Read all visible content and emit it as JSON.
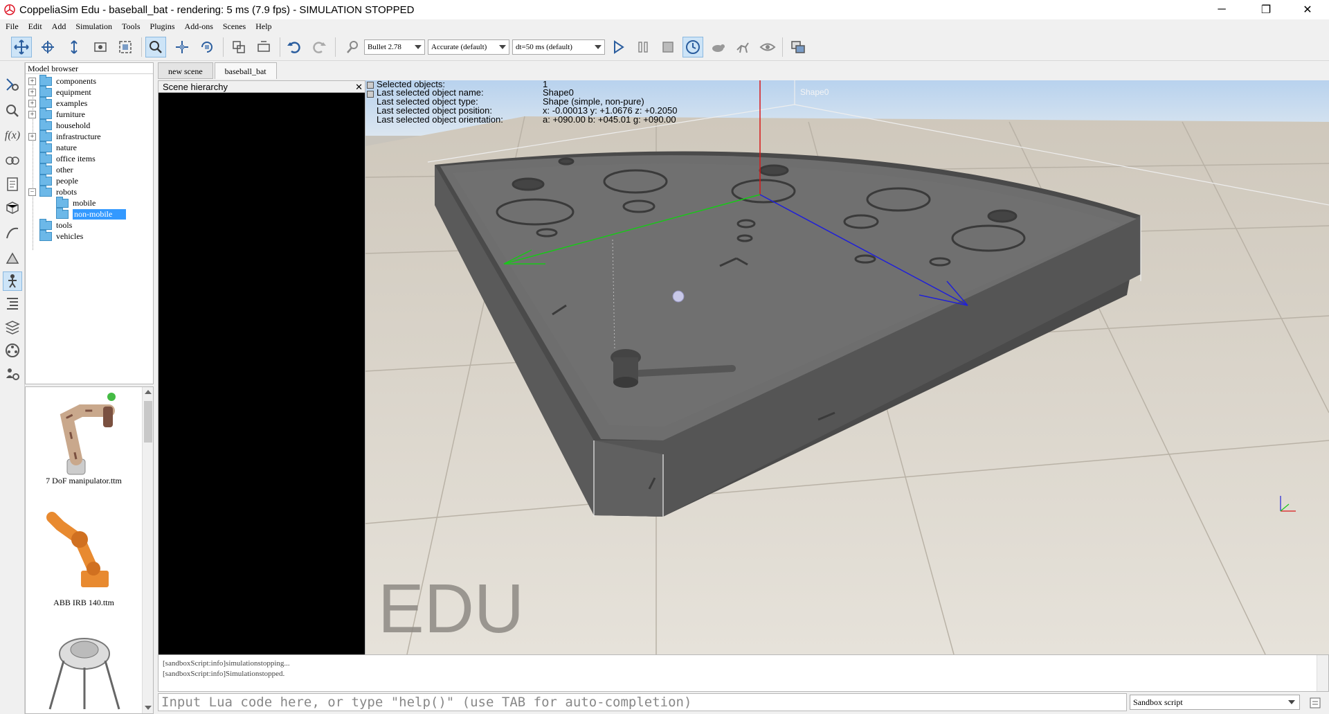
{
  "window": {
    "title": "CoppeliaSim Edu - baseball_bat - rendering: 5 ms (7.9 fps) - SIMULATION STOPPED",
    "minimize": "─",
    "maximize": "❐",
    "close": "✕"
  },
  "menu": [
    "File",
    "Edit",
    "Add",
    "Simulation",
    "Tools",
    "Plugins",
    "Add-ons",
    "Scenes",
    "Help"
  ],
  "toolbar": {
    "engine": "Bullet 2.78",
    "accuracy": "Accurate (default)",
    "timestep": "dt=50 ms (default)"
  },
  "model_browser": {
    "header": "Model browser",
    "items": [
      {
        "label": "components",
        "expandable": "+"
      },
      {
        "label": "equipment",
        "expandable": "+"
      },
      {
        "label": "examples",
        "expandable": "+"
      },
      {
        "label": "furniture",
        "expandable": "+"
      },
      {
        "label": "household",
        "expandable": ""
      },
      {
        "label": "infrastructure",
        "expandable": "+"
      },
      {
        "label": "nature",
        "expandable": ""
      },
      {
        "label": "office items",
        "expandable": ""
      },
      {
        "label": "other",
        "expandable": ""
      },
      {
        "label": "people",
        "expandable": ""
      },
      {
        "label": "robots",
        "expandable": "−"
      },
      {
        "label": "mobile",
        "expandable": ""
      },
      {
        "label": "non-mobile",
        "expandable": ""
      },
      {
        "label": "tools",
        "expandable": ""
      },
      {
        "label": "vehicles",
        "expandable": ""
      }
    ]
  },
  "thumbnails": [
    {
      "label": "7 DoF manipulator.ttm"
    },
    {
      "label": "ABB IRB 140.ttm"
    }
  ],
  "tabs": [
    "new scene",
    "baseball_bat"
  ],
  "scene_hierarchy": {
    "header": "Scene hierarchy",
    "close": "✕"
  },
  "info": {
    "rows": [
      {
        "label": "Selected objects:",
        "value": "1"
      },
      {
        "label": "Last selected object name:",
        "value": "Shape0"
      },
      {
        "label": "Last selected object type:",
        "value": "Shape (simple, non-pure)"
      },
      {
        "label": "Last selected object position:",
        "value": "x: -0.00013   y: +1.0676   z: +0.2050"
      },
      {
        "label": "Last selected object orientation:",
        "value": "a: +090.00   b: +045.01   g: +090.00"
      }
    ],
    "object_tag": "Shape0",
    "watermark": "EDU"
  },
  "console": {
    "lines": [
      "[sandboxScript:info]simulationstopping...",
      "[sandboxScript:info]Simulationstopped."
    ]
  },
  "command": {
    "placeholder": "Input Lua code here, or type \"help()\" (use TAB for auto-completion)",
    "script": "Sandbox script"
  }
}
